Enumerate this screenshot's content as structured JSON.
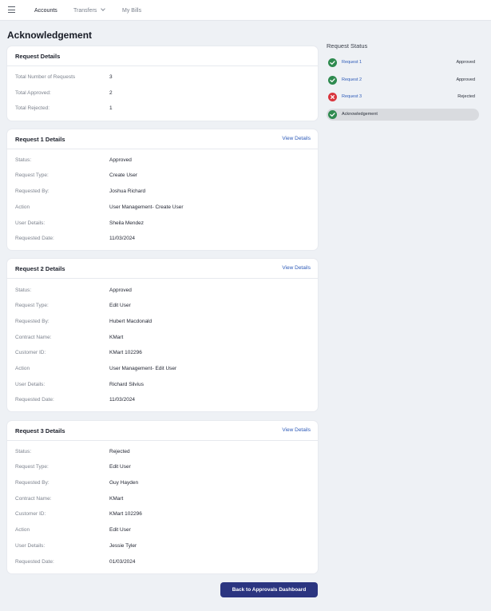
{
  "nav": {
    "items": [
      {
        "label": "Accounts",
        "active": true
      },
      {
        "label": "Transfers",
        "dropdown": true
      },
      {
        "label": "My Bills"
      }
    ]
  },
  "page_title": "Acknowledgement",
  "summary": {
    "title": "Request Details",
    "rows": [
      {
        "label": "Total Number of Requests",
        "value": "3"
      },
      {
        "label": "Total Approved:",
        "value": "2"
      },
      {
        "label": "Total Rejected:",
        "value": "1"
      }
    ]
  },
  "requests": [
    {
      "title": "Request 1 Details",
      "link": "View Details",
      "rows": [
        {
          "label": "Status:",
          "value": "Approved"
        },
        {
          "label": "Request Type:",
          "value": "Create User"
        },
        {
          "label": "Requested By:",
          "value": "Joshua Richard"
        },
        {
          "label": "Action",
          "value": "User Management- Create User"
        },
        {
          "label": "User Details:",
          "value": "Sheila Mendez"
        },
        {
          "label": "Requested Date:",
          "value": "11/03/2024"
        }
      ]
    },
    {
      "title": "Request 2 Details",
      "link": "View Details",
      "rows": [
        {
          "label": "Status:",
          "value": "Approved"
        },
        {
          "label": "Request Type:",
          "value": "Edit User"
        },
        {
          "label": "Requested By:",
          "value": "Hubert Macdonald"
        },
        {
          "label": "Contract Name:",
          "value": "KMart"
        },
        {
          "label": "Customer ID:",
          "value": "KMart 102296"
        },
        {
          "label": "Action",
          "value": "User Management- Edit User"
        },
        {
          "label": "User Details:",
          "value": "Richard Silvius"
        },
        {
          "label": "Requested Date:",
          "value": "11/03/2024"
        }
      ]
    },
    {
      "title": "Request 3 Details",
      "link": "View Details",
      "rows": [
        {
          "label": "Status:",
          "value": "Rejected"
        },
        {
          "label": "Request Type:",
          "value": "Edit User"
        },
        {
          "label": "Requested By:",
          "value": "Guy Hayden"
        },
        {
          "label": "Contract Name:",
          "value": "KMart"
        },
        {
          "label": "Customer ID:",
          "value": "KMart 102296"
        },
        {
          "label": "Action",
          "value": "Edit User"
        },
        {
          "label": "User Details:",
          "value": "Jessie Tyler"
        },
        {
          "label": "Requested Date:",
          "value": "01/03/2024"
        }
      ]
    }
  ],
  "status_panel": {
    "title": "Request Status",
    "steps": [
      {
        "label": "Request 1",
        "status": "Approved",
        "icon": "check-icon",
        "state": "ok"
      },
      {
        "label": "Request 2",
        "status": "Approved",
        "icon": "check-icon",
        "state": "ok"
      },
      {
        "label": "Request 3",
        "status": "Rejected",
        "icon": "cross-icon",
        "state": "bad"
      },
      {
        "label": "Acknowledgement",
        "status": "",
        "icon": "check-icon",
        "state": "ok",
        "current": true
      }
    ]
  },
  "cta_label": "Back to Approvals Dashboard",
  "colors": {
    "accent": "#2b3580",
    "link": "#2e5bb8",
    "success": "#2e8a4f",
    "error": "#d9363e",
    "background": "#eef1f5"
  }
}
